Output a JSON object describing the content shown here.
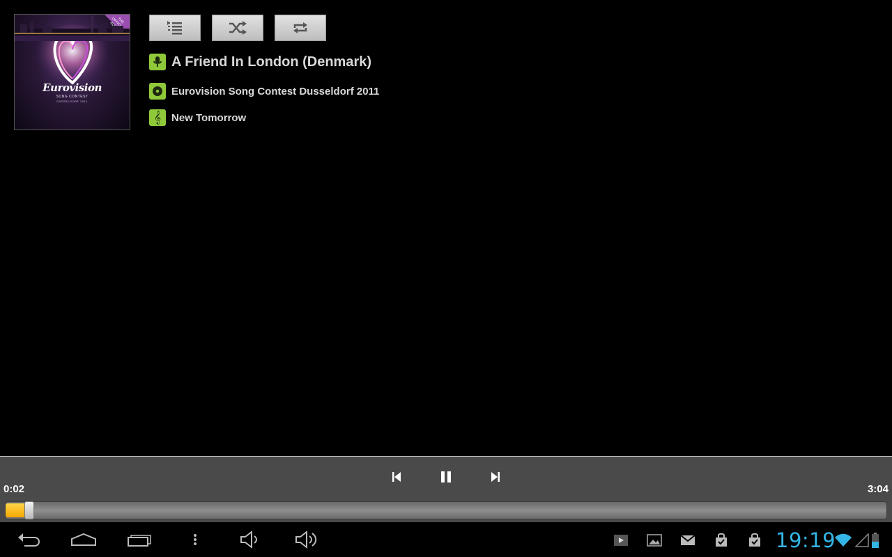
{
  "album_art": {
    "logo_text": "Eurovision",
    "subtitle": "SONG CONTEST",
    "subtitle2": "DÜSSELDORF 2011",
    "corner_text": "THE OFFICIAL ALBUM"
  },
  "mode_buttons": [
    {
      "name": "playlist",
      "icon": "queue-list-icon"
    },
    {
      "name": "shuffle",
      "icon": "shuffle-icon"
    },
    {
      "name": "repeat",
      "icon": "repeat-icon"
    }
  ],
  "track": {
    "title": "A Friend In London (Denmark)",
    "album": "Eurovision Song Contest Dusseldorf 2011",
    "artist": "New Tomorrow",
    "title_icon": "microphone-icon",
    "album_icon": "disc-icon",
    "artist_icon": "treble-clef-icon",
    "icon_color": "#8fc93a"
  },
  "playback": {
    "elapsed": "0:02",
    "total": "3:04",
    "progress_fraction": 0.011,
    "controls": [
      "previous-icon",
      "pause-icon",
      "next-icon"
    ],
    "accent_color": "#f5a800"
  },
  "status_bar": {
    "clock": "19:19",
    "clock_color": "#33b5e5",
    "notification_icons": [
      "play-store-icon",
      "gallery-icon",
      "gmail-icon",
      "market-update-icon",
      "market-update-icon"
    ],
    "status_icons": [
      "wifi-icon",
      "signal-icon",
      "battery-icon"
    ]
  },
  "nav_bar": [
    "back-icon",
    "home-icon",
    "recent-apps-icon",
    "menu-icon",
    "volume-down-icon",
    "volume-up-icon"
  ]
}
